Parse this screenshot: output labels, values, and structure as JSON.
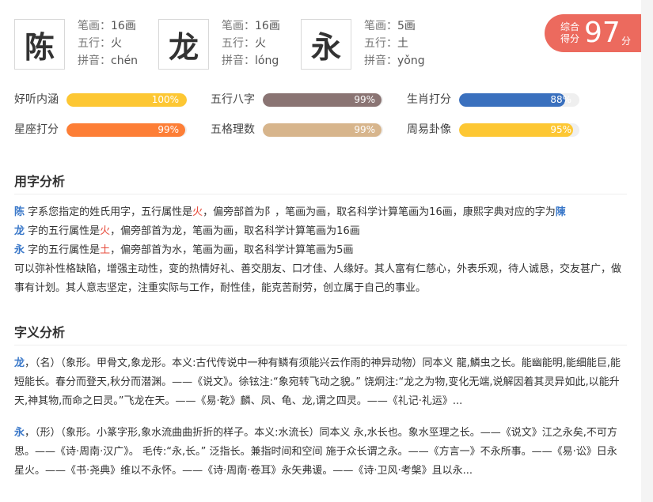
{
  "characters": [
    {
      "char": "陈",
      "strokes_label": "笔画：",
      "strokes": "16画",
      "element_label": "五行：",
      "element": "火",
      "pinyin_label": "拼音：",
      "pinyin": "chén"
    },
    {
      "char": "龙",
      "strokes_label": "笔画：",
      "strokes": "16画",
      "element_label": "五行：",
      "element": "火",
      "pinyin_label": "拼音：",
      "pinyin": "lóng"
    },
    {
      "char": "永",
      "strokes_label": "笔画：",
      "strokes": "5画",
      "element_label": "五行：",
      "element": "土",
      "pinyin_label": "拼音：",
      "pinyin": "yǒng"
    }
  ],
  "score": {
    "label_line1": "综合",
    "label_line2": "得分",
    "value": "97",
    "unit": "分",
    "color": "#ec6a5e"
  },
  "metrics": [
    {
      "label": "好听内涵",
      "value": 1.0,
      "text": "100%",
      "color": "#fdc733"
    },
    {
      "label": "五行八字",
      "value": 0.99,
      "text": "99%",
      "color": "#8a7473"
    },
    {
      "label": "生肖打分",
      "value": 0.88,
      "text": "88%",
      "color": "#3a70be"
    },
    {
      "label": "星座打分",
      "value": 0.99,
      "text": "99%",
      "color": "#fd7e36"
    },
    {
      "label": "五格理数",
      "value": 0.99,
      "text": "99%",
      "color": "#d7b58c"
    },
    {
      "label": "周易卦像",
      "value": 0.95,
      "text": "95%",
      "color": "#fdc733"
    }
  ],
  "usage": {
    "title": "用字分析",
    "line1_char": "陈",
    "line1_a": " 字系您指定的姓氏用字，五行属性是",
    "line1_elem": "火",
    "line1_b": "，偏旁部首为阝，笔画为画，取名科学计算笔画为16画，康熙字典对应的字为",
    "line1_kx": "陳",
    "line2_char": "龙",
    "line2_a": " 字的五行属性是",
    "line2_elem": "火",
    "line2_b": "，偏旁部首为龙，笔画为画，取名科学计算笔画为16画",
    "line3_char": "永",
    "line3_a": " 字的五行属性是",
    "line3_elem": "土",
    "line3_b": "，偏旁部首为水，笔画为画，取名科学计算笔画为5画",
    "desc": "可以弥补性格缺陷，增强主动性，变的热情好礼、善交朋友、口才佳、人缘好。其人富有仁慈心，外表乐观，待人诚恳，交友甚广，做事有计划。其人意志坚定，注重实际与工作，耐性佳，能克苦耐劳，创立属于自己的事业。"
  },
  "meaning": {
    "title": "字义分析",
    "entries": [
      {
        "char": "龙",
        "text": "，（名）（象形。甲骨文,象龙形。本义:古代传说中一种有鳞有须能兴云作雨的神异动物）同本义 龍,鱗虫之长。能幽能明,能细能巨,能短能长。春分而登天,秋分而潜渊。——《说文》。徐铉注:“象宛转飞动之貌。” 饶炯注:“龙之为物,变化无端,说解因着其灵异如此,以能升天,神其物,而命之曰灵。”飞龙在天。——《易·乾》麟、凤、龟、龙,谓之四灵。——《礼记·礼运》..."
      },
      {
        "char": "永",
        "text": "，（形）（象形。小篆字形,象水流曲曲折折的样子。本义:水流长）同本义 永,水长也。象水巠理之长。——《说文》江之永矣,不可方思。——《诗·周南·汉广》。 毛传:“永,长。” 泛指长。兼指时间和空间 施于众长谓之永。——《方言一》不永所事。——《易·讼》日永星火。——《书·尧典》维以不永怀。——《诗·周南·卷耳》永矢弗谖。——《诗·卫风·考槃》且以永..."
      }
    ]
  }
}
